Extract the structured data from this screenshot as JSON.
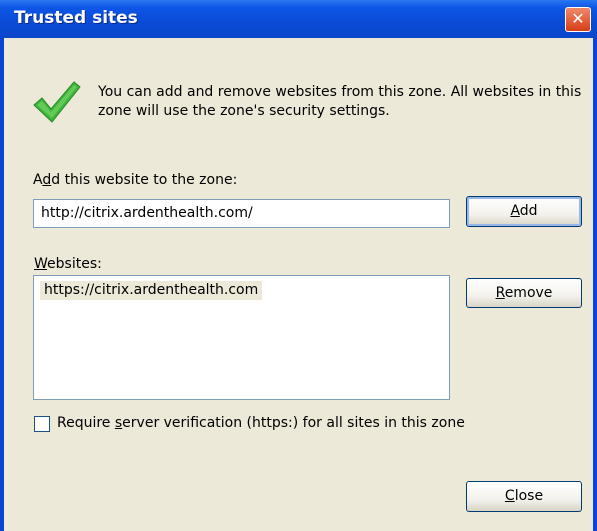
{
  "window": {
    "title": "Trusted sites",
    "close_glyph": "✕"
  },
  "description": "You can add and remove websites from this zone. All websites in this zone will use the zone's security settings.",
  "add_label": {
    "pre": "A",
    "key": "d",
    "post": "d this website to the zone:"
  },
  "url_input": {
    "value": "http://citrix.ardenthealth.com/"
  },
  "add_button": {
    "key": "A",
    "rest": "dd"
  },
  "websites_label": {
    "key": "W",
    "rest": "ebsites:"
  },
  "websites": [
    "https://citrix.ardenthealth.com"
  ],
  "remove_button": {
    "key": "R",
    "rest": "emove"
  },
  "require_checkbox": {
    "pre": "Require ",
    "key": "s",
    "post": "erver verification (https:) for all sites in this zone",
    "checked": false
  },
  "close_button": {
    "key": "C",
    "rest": "lose"
  },
  "icons": {
    "check": "check-icon"
  }
}
